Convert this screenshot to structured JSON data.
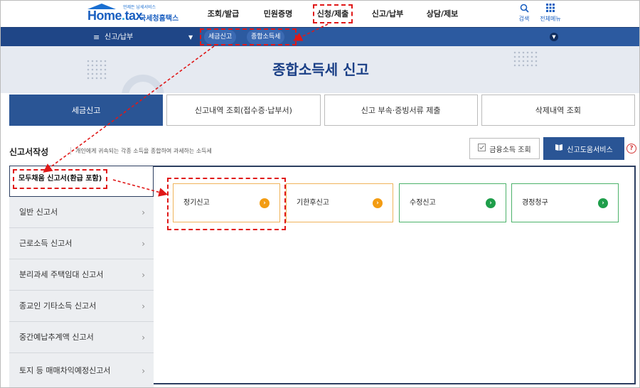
{
  "header": {
    "logo_tagline": "언제든 납세서비스",
    "logo_main_a": "Home",
    "logo_main_b": "tax",
    "logo_kr": "국세청홈택스",
    "menu": [
      "조회/발급",
      "민원증명",
      "신청/제출",
      "신고/납부",
      "상담/제보"
    ],
    "search_label": "검색",
    "all_menu_label": "전체메뉴"
  },
  "nav": {
    "menu_label": "신고/납부",
    "crumbs": [
      "세금신고",
      "종합소득세"
    ]
  },
  "hero": {
    "title": "종합소득세 신고"
  },
  "tabs": [
    "세금신고",
    "신고내역 조회(접수증·납부서)",
    "신고 부속·증빙서류 제출",
    "삭제내역 조회"
  ],
  "section": {
    "title": "신고서작성",
    "description": "개인에게 귀속되는 각종 소득을 종합하여 과세하는 소득세",
    "fin_button": "금융소득 조회",
    "help_button": "신고도움서비스",
    "help_q": "?"
  },
  "sidebar": {
    "items": [
      "모두채움 신고서(환급 포함)",
      "일반 신고서",
      "근로소득 신고서",
      "분리과세 주택임대 신고서",
      "종교인 기타소득 신고서",
      "중간예납추계액 신고서",
      "토지 등 매매차익예정신고서"
    ]
  },
  "cards": [
    "정기신고",
    "기한후신고",
    "수정신고",
    "경정청구"
  ],
  "colors": {
    "primary": "#2a5595",
    "navbar": "#2c5aa0",
    "annotation": "#e01818",
    "card_orange": "#f39c12",
    "card_green": "#1e9e4a"
  }
}
